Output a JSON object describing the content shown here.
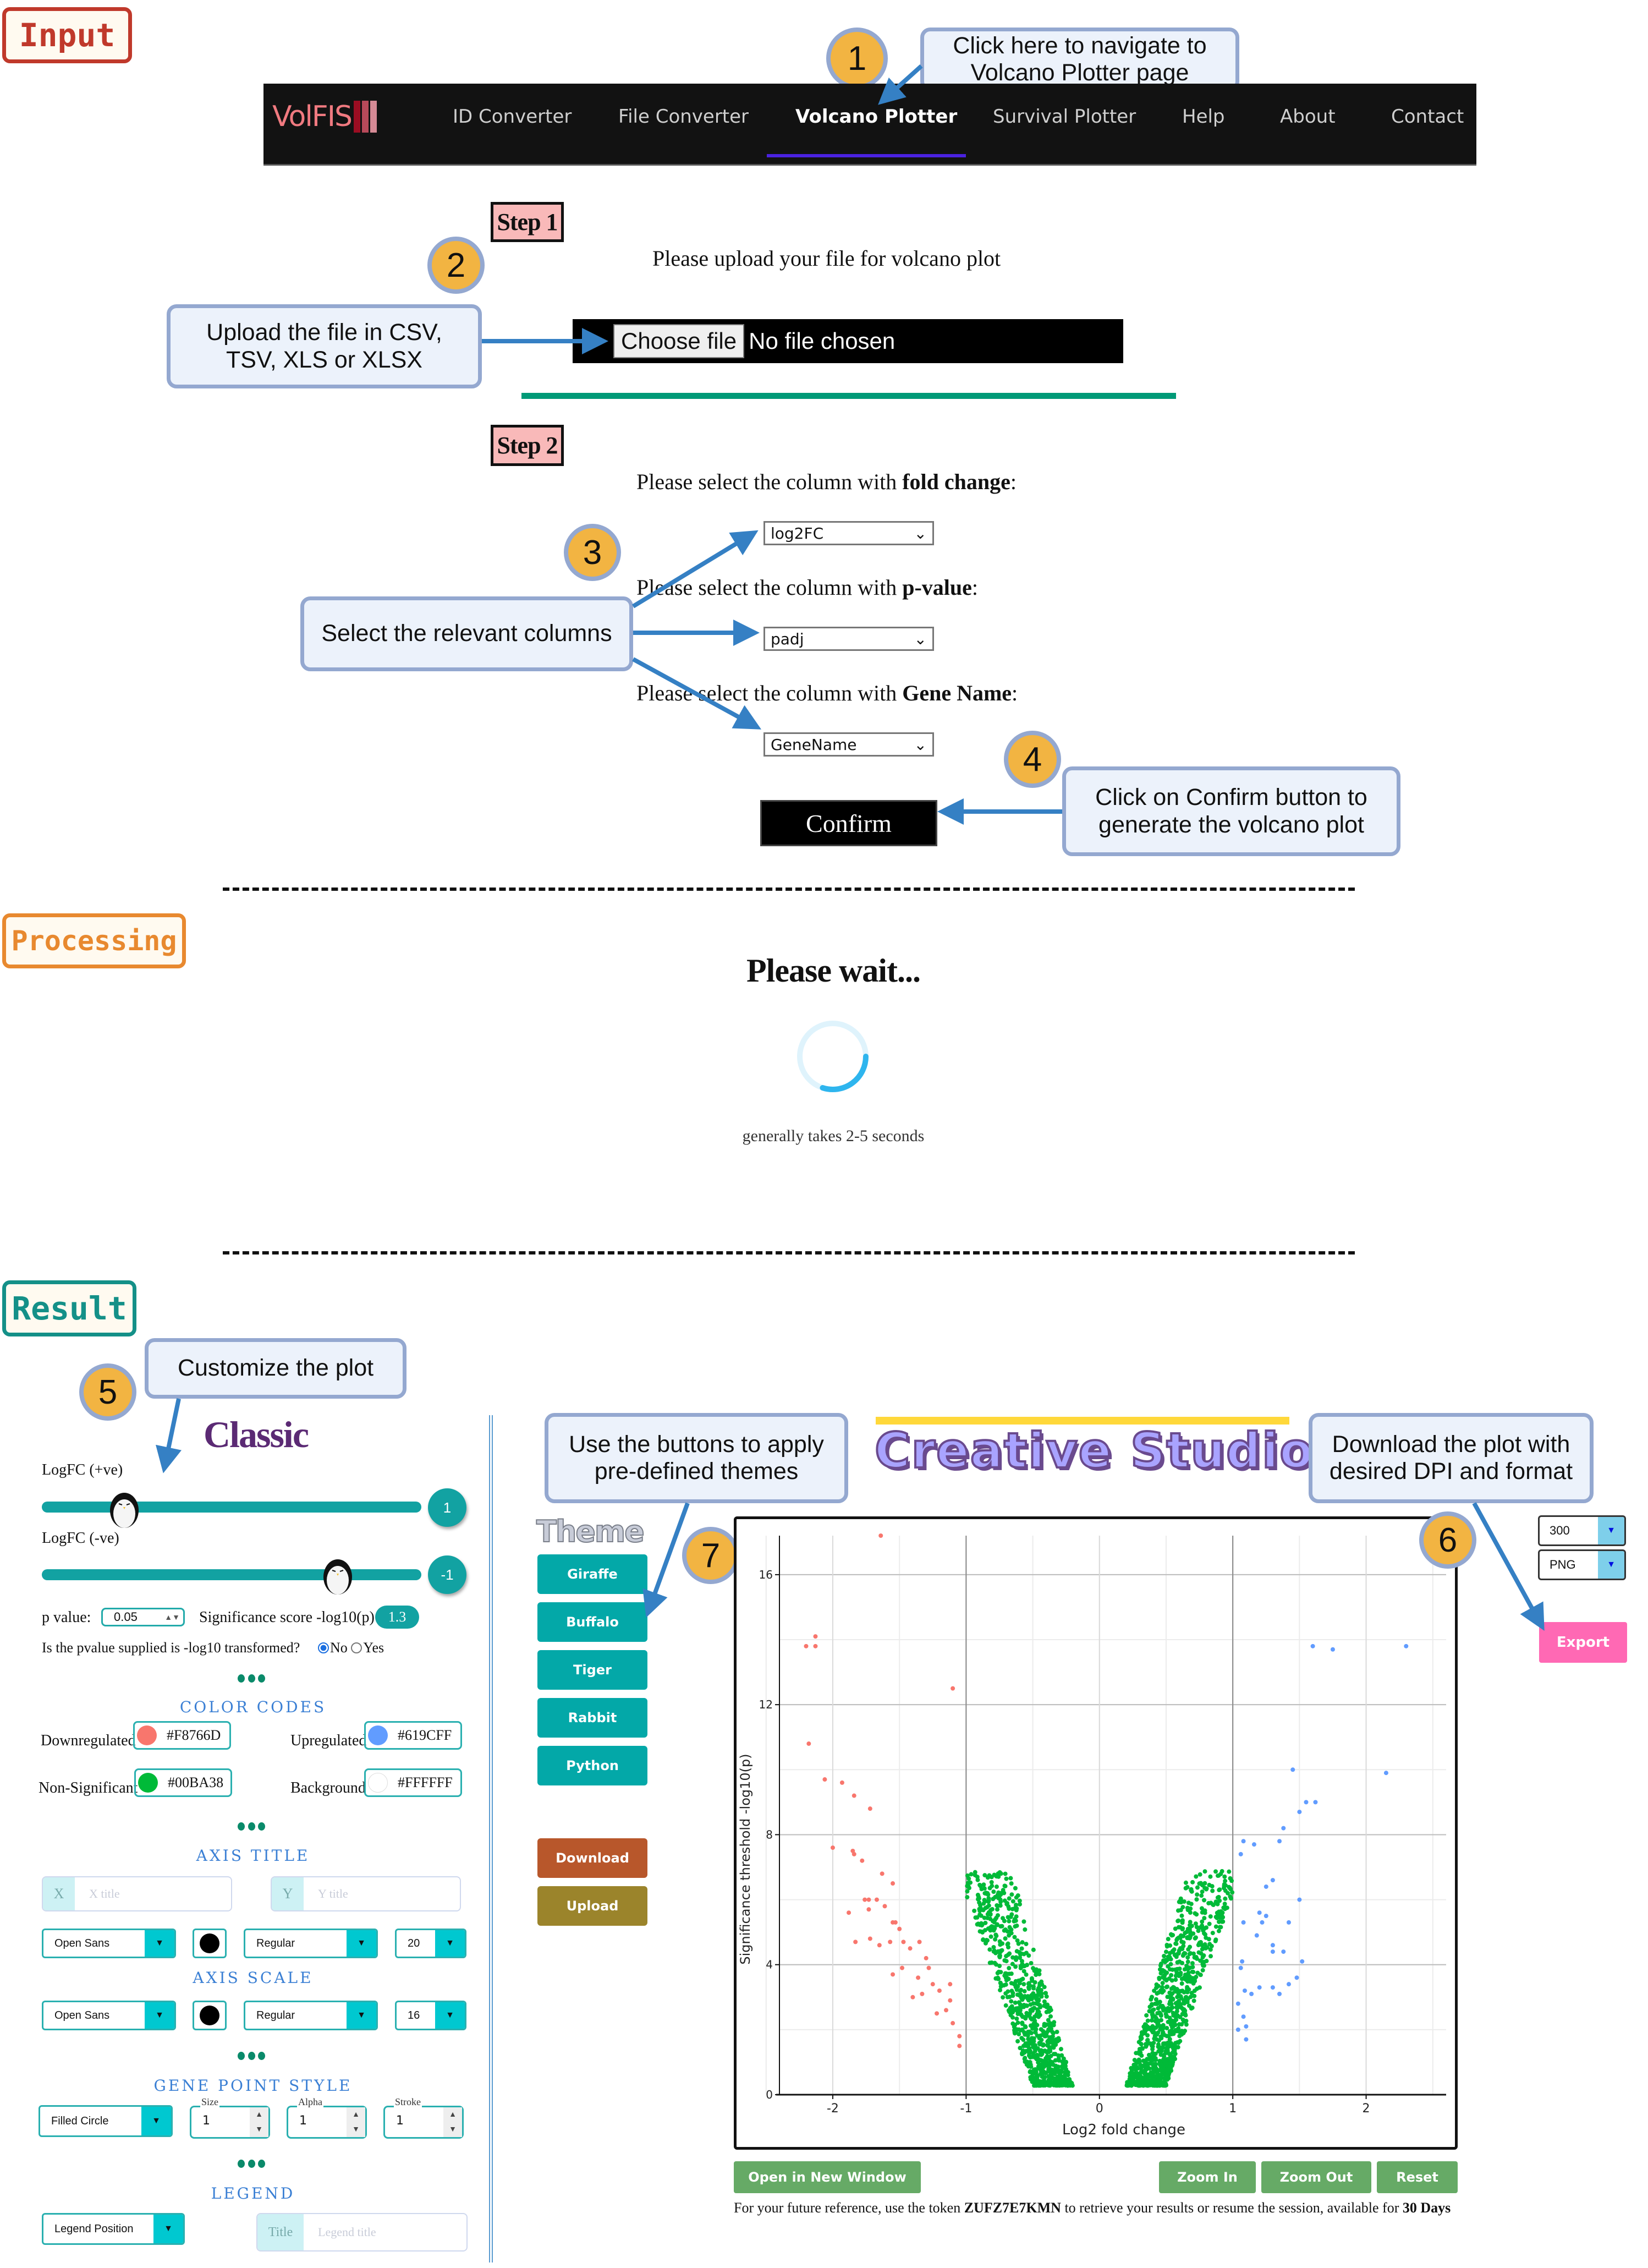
{
  "sections": {
    "input": "Input",
    "processing": "Processing",
    "result": "Result"
  },
  "navbar": {
    "brand": "VolFIS",
    "brand_bar_colors": [
      "#9b0d22",
      "#b84a5a",
      "#d58a95"
    ],
    "items": [
      {
        "label": "ID Converter",
        "active": false
      },
      {
        "label": "File Converter",
        "active": false
      },
      {
        "label": "Volcano Plotter",
        "active": true
      },
      {
        "label": "Survival Plotter",
        "active": false
      },
      {
        "label": "Help",
        "active": false
      },
      {
        "label": "About",
        "active": false
      },
      {
        "label": "Contact",
        "active": false
      }
    ],
    "active_underline_color": "#4a22e0"
  },
  "callouts": {
    "c1": {
      "number": "1",
      "text": "Click here to navigate to Volcano Plotter page"
    },
    "c2": {
      "number": "2",
      "text": "Upload the file in CSV, TSV, XLS or XLSX"
    },
    "c3": {
      "number": "3",
      "text": "Select the relevant columns"
    },
    "c4": {
      "number": "4",
      "text": "Click on Confirm button to generate the volcano plot"
    },
    "c5": {
      "number": "5",
      "text": "Customize the plot"
    },
    "c6": {
      "number": "6",
      "text": "Download the plot with desired DPI and format"
    },
    "c7": {
      "number": "7",
      "text": "Use the buttons to apply pre-defined themes"
    }
  },
  "step1": {
    "label": "Step 1",
    "prompt": "Please upload your file for volcano plot",
    "choose_file": "Choose file",
    "file_status": "No file chosen"
  },
  "step2": {
    "label": "Step 2",
    "fold_change_prompt": "Please select the column with ",
    "fold_change_bold": "fold change",
    "fold_change_value": "log2FC",
    "pvalue_prompt": "Please select the column with ",
    "pvalue_bold": "p-value",
    "pvalue_value": "padj",
    "gene_prompt": "Please select the column with ",
    "gene_bold": "Gene Name",
    "gene_value": "GeneName",
    "colon": ":",
    "confirm": "Confirm"
  },
  "processing": {
    "title": "Please wait...",
    "subtitle": "generally takes 2-5 seconds",
    "spinner_progress": 0.3
  },
  "controls": {
    "title": "Classic",
    "logfc_pos_label": "LogFC (+ve)",
    "logfc_pos_value": "1",
    "logfc_neg_label": "LogFC (-ve)",
    "logfc_neg_value": "-1",
    "pvalue_label": "p value:",
    "pvalue_value": "0.05",
    "sig_label": "Significance score -log10(p)",
    "sig_value": "1.3",
    "transform_question": "Is the pvalue supplied is -log10 transformed?",
    "transform_options": [
      {
        "label": "No",
        "selected": true
      },
      {
        "label": "Yes",
        "selected": false
      }
    ],
    "color_codes_title": "COLOR CODES",
    "colors": [
      {
        "label": "Downregulated",
        "hex": "#F8766D"
      },
      {
        "label": "Upregulated",
        "hex": "#619CFF"
      },
      {
        "label": "Non-Significant",
        "hex": "#00BA38"
      },
      {
        "label": "Background",
        "hex": "#FFFFFF"
      }
    ],
    "axis_title_header": "AXIS TITLE",
    "x_prefix": "X",
    "x_placeholder": "X title",
    "y_prefix": "Y",
    "y_placeholder": "Y title",
    "axis_title_font": "Open Sans",
    "axis_title_weight": "Regular",
    "axis_title_size": "20",
    "axis_scale_header": "AXIS SCALE",
    "axis_scale_font": "Open Sans",
    "axis_scale_weight": "Regular",
    "axis_scale_size": "16",
    "gene_point_header": "GENE POINT STYLE",
    "point_shape": "Filled Circle",
    "size_label": "Size",
    "size_value": "1",
    "alpha_label": "Alpha",
    "alpha_value": "1",
    "stroke_label": "Stroke",
    "stroke_value": "1",
    "legend_header": "LEGEND",
    "legend_position": "Legend Position",
    "legend_prefix": "Title",
    "legend_placeholder": "Legend title"
  },
  "themes": {
    "title": "Theme",
    "buttons": [
      {
        "label": "Giraffe",
        "color": "#03a8a8"
      },
      {
        "label": "Buffalo",
        "color": "#03a8a8"
      },
      {
        "label": "Tiger",
        "color": "#03a8a8"
      },
      {
        "label": "Rabbit",
        "color": "#03a8a8"
      },
      {
        "label": "Python",
        "color": "#03a8a8"
      }
    ],
    "download": {
      "label": "Download",
      "color": "#b8572b"
    },
    "upload": {
      "label": "Upload",
      "color": "#9b842b"
    }
  },
  "studio": {
    "title": "Creative Studio"
  },
  "export": {
    "dpi": "300",
    "format": "PNG",
    "button": "Export"
  },
  "plot_actions": {
    "open_new_window": "Open in New Window",
    "zoom_in": "Zoom In",
    "zoom_out": "Zoom Out",
    "reset": "Reset"
  },
  "token_note": {
    "prefix": "For your future reference, use the token ",
    "token": "ZUFZ7E7KMN",
    "middle": " to retrieve your results or resume the session, available for ",
    "duration": "30 Days"
  },
  "chart_data": {
    "type": "scatter",
    "title": "",
    "xlabel": "Log2 fold change",
    "ylabel": "Significance threshold -log10(p)",
    "xlim": [
      -2.4,
      2.6
    ],
    "ylim": [
      0,
      17.2
    ],
    "xticks": [
      "-2",
      "-1",
      "0",
      "1",
      "2"
    ],
    "xtick_values": [
      -2,
      -1,
      0,
      1,
      2
    ],
    "yticks": [
      "0",
      "4",
      "8",
      "12",
      "16"
    ],
    "ytick_values": [
      0,
      4,
      8,
      12,
      16
    ],
    "grid": true,
    "thresholds": {
      "logfc_pos": 1,
      "logfc_neg": -1,
      "neg_log10_p": 1.3
    },
    "series": [
      {
        "name": "Downregulated",
        "color": "#F8766D",
        "points": [
          [
            -1.64,
            17.2
          ],
          [
            -2.2,
            13.8
          ],
          [
            -2.13,
            14.1
          ],
          [
            -2.13,
            13.8
          ],
          [
            -1.1,
            12.5
          ],
          [
            -2.18,
            10.8
          ],
          [
            -2.06,
            9.7
          ],
          [
            -1.93,
            9.6
          ],
          [
            -1.72,
            8.8
          ],
          [
            -1.84,
            9.2
          ],
          [
            -2.0,
            7.6
          ],
          [
            -1.78,
            7.2
          ],
          [
            -1.85,
            7.5
          ],
          [
            -1.84,
            7.4
          ],
          [
            -1.63,
            6.8
          ],
          [
            -1.55,
            6.5
          ],
          [
            -1.88,
            5.6
          ],
          [
            -1.76,
            6.0
          ],
          [
            -1.73,
            6.0
          ],
          [
            -1.67,
            6.0
          ],
          [
            -1.73,
            5.7
          ],
          [
            -1.61,
            5.8
          ],
          [
            -1.53,
            5.3
          ],
          [
            -1.55,
            5.3
          ],
          [
            -1.5,
            5.1
          ],
          [
            -1.83,
            4.7
          ],
          [
            -1.72,
            4.8
          ],
          [
            -1.65,
            4.6
          ],
          [
            -1.57,
            4.7
          ],
          [
            -1.47,
            4.7
          ],
          [
            -1.42,
            4.5
          ],
          [
            -1.35,
            4.7
          ],
          [
            -1.3,
            4.2
          ],
          [
            -1.55,
            3.7
          ],
          [
            -1.48,
            3.9
          ],
          [
            -1.36,
            3.6
          ],
          [
            -1.28,
            3.9
          ],
          [
            -1.25,
            3.4
          ],
          [
            -1.33,
            3.1
          ],
          [
            -1.4,
            3.0
          ],
          [
            -1.2,
            3.2
          ],
          [
            -1.12,
            3.4
          ],
          [
            -1.15,
            2.6
          ],
          [
            -1.1,
            2.2
          ],
          [
            -1.05,
            1.8
          ],
          [
            -1.05,
            1.5
          ],
          [
            -1.12,
            2.9
          ],
          [
            -1.22,
            2.5
          ]
        ]
      },
      {
        "name": "Upregulated",
        "color": "#619CFF",
        "points": [
          [
            1.6,
            13.8
          ],
          [
            1.75,
            13.7
          ],
          [
            2.3,
            13.8
          ],
          [
            1.45,
            10.0
          ],
          [
            2.15,
            9.9
          ],
          [
            1.55,
            9.0
          ],
          [
            1.62,
            9.0
          ],
          [
            1.5,
            8.7
          ],
          [
            1.38,
            8.2
          ],
          [
            1.35,
            7.8
          ],
          [
            1.08,
            7.8
          ],
          [
            1.16,
            7.7
          ],
          [
            1.06,
            7.4
          ],
          [
            1.3,
            6.6
          ],
          [
            1.25,
            6.4
          ],
          [
            1.5,
            6.0
          ],
          [
            1.2,
            5.6
          ],
          [
            1.25,
            5.5
          ],
          [
            1.08,
            5.3
          ],
          [
            1.22,
            5.3
          ],
          [
            1.42,
            5.3
          ],
          [
            1.18,
            4.9
          ],
          [
            1.3,
            4.6
          ],
          [
            1.3,
            4.4
          ],
          [
            1.38,
            4.4
          ],
          [
            1.52,
            4.1
          ],
          [
            1.07,
            4.1
          ],
          [
            1.06,
            3.9
          ],
          [
            1.48,
            3.6
          ],
          [
            1.3,
            3.3
          ],
          [
            1.09,
            3.2
          ],
          [
            1.14,
            3.1
          ],
          [
            1.2,
            3.3
          ],
          [
            1.42,
            3.4
          ],
          [
            1.35,
            3.1
          ],
          [
            1.04,
            2.8
          ],
          [
            1.08,
            2.4
          ],
          [
            1.04,
            2.0
          ],
          [
            1.1,
            2.1
          ],
          [
            1.1,
            1.7
          ]
        ]
      },
      {
        "name": "Non-Significant",
        "color": "#00BA38",
        "shape": "two-cone",
        "envelope": {
          "left_inner": -0.2,
          "left_outer_at_base": -0.5,
          "right_inner": 0.2,
          "right_outer_at_base": 0.5,
          "max_height": 6.6,
          "approx_count": 1800
        }
      }
    ]
  }
}
